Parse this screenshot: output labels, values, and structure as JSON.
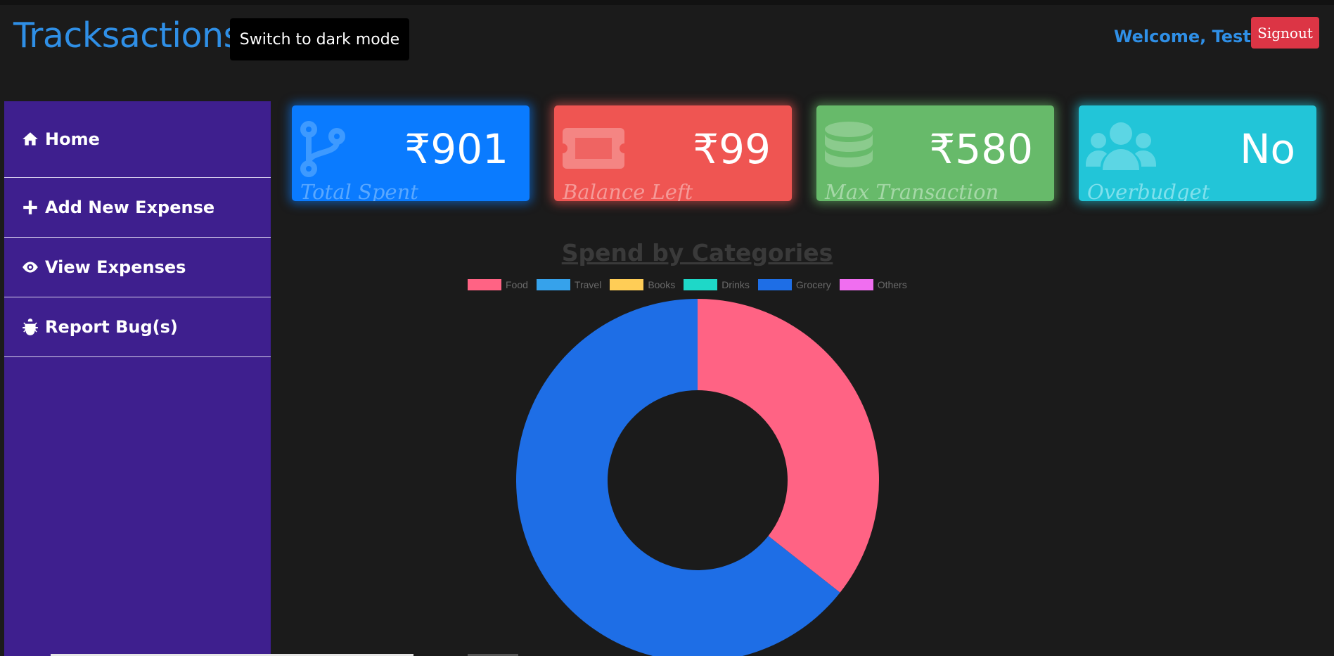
{
  "header": {
    "brand": "Tracksactions",
    "mode_toggle_label": "Switch to dark mode",
    "welcome": "Welcome, Test",
    "signout_label": "Signout",
    "brand_color": "#2f8fe6"
  },
  "sidebar": {
    "items": [
      {
        "label": "Home",
        "icon": "home-icon"
      },
      {
        "label": "Add New Expense",
        "icon": "plus-icon"
      },
      {
        "label": "View Expenses",
        "icon": "eye-icon"
      },
      {
        "label": "Report Bug(s)",
        "icon": "bug-icon"
      }
    ],
    "color": "#3e1f8e"
  },
  "stats": [
    {
      "value": "₹901",
      "label": "Total Spent",
      "icon": "code-branch-icon",
      "color": "#0a7bff"
    },
    {
      "value": "₹99",
      "label": "Balance Left",
      "icon": "ticket-icon",
      "color": "#ef5552"
    },
    {
      "value": "₹580",
      "label": "Max Transaction",
      "icon": "database-icon",
      "color": "#67ba6a"
    },
    {
      "value": "No",
      "label": "Overbudget",
      "icon": "users-icon",
      "color": "#22c5d8"
    }
  ],
  "chart_data": {
    "type": "pie",
    "title": "Spend by Categories",
    "categories": [
      "Food",
      "Travel",
      "Books",
      "Drinks",
      "Grocery",
      "Others"
    ],
    "values": [
      321,
      0,
      0,
      0,
      580,
      0
    ],
    "colors": [
      "#ff6384",
      "#36a2eb",
      "#ffcd56",
      "#1ed8c8",
      "#1e6ee6",
      "#f06ef0"
    ],
    "donut": true,
    "legend_position": "top"
  }
}
